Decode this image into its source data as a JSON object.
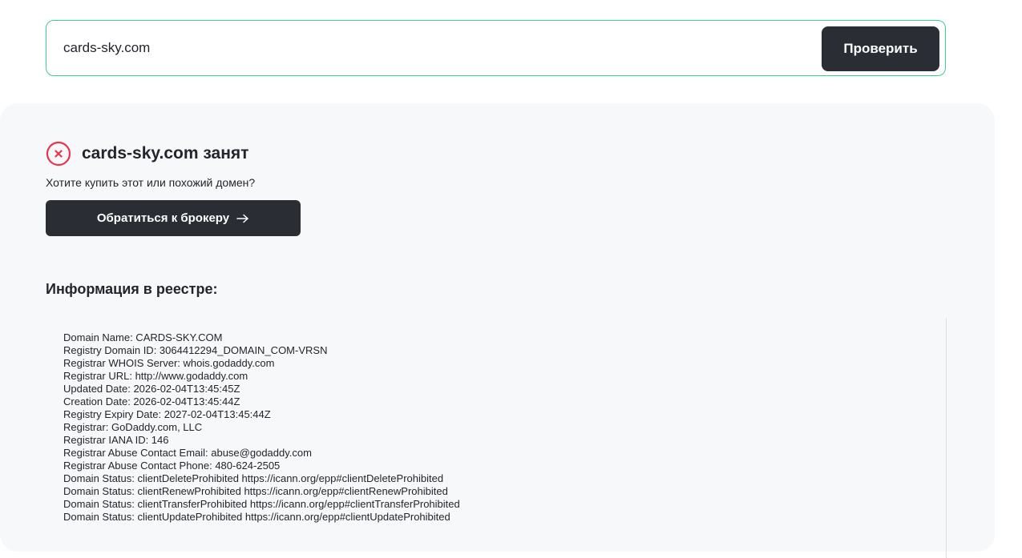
{
  "search": {
    "value": "cards-sky.com",
    "button_label": "Проверить"
  },
  "result": {
    "status_icon": "close-circle-icon",
    "title": "cards-sky.com занят",
    "prompt": "Хотите купить этот или похожий домен?",
    "broker_button_label": "Обратиться к брокеру",
    "broker_button_icon": "arrow-right-icon"
  },
  "registry": {
    "heading": "Информация в реестре:",
    "lines": [
      "Domain Name: CARDS-SKY.COM",
      "Registry Domain ID: 3064412294_DOMAIN_COM-VRSN",
      "Registrar WHOIS Server: whois.godaddy.com",
      "Registrar URL: http://www.godaddy.com",
      "Updated Date: 2026-02-04T13:45:45Z",
      "Creation Date: 2026-02-04T13:45:44Z",
      "Registry Expiry Date: 2027-02-04T13:45:44Z",
      "Registrar: GoDaddy.com, LLC",
      "Registrar IANA ID: 146",
      "Registrar Abuse Contact Email: abuse@godaddy.com",
      "Registrar Abuse Contact Phone: 480-624-2505",
      "Domain Status: clientDeleteProhibited https://icann.org/epp#clientDeleteProhibited",
      "Domain Status: clientRenewProhibited https://icann.org/epp#clientRenewProhibited",
      "Domain Status: clientTransferProhibited https://icann.org/epp#clientTransferProhibited",
      "Domain Status: clientUpdateProhibited https://icann.org/epp#clientUpdateProhibited"
    ]
  },
  "colors": {
    "accent_border": "#3ecf8e",
    "dark_button": "#2a2d33",
    "error_red": "#e8344e",
    "panel_bg": "#f7f8fa"
  }
}
